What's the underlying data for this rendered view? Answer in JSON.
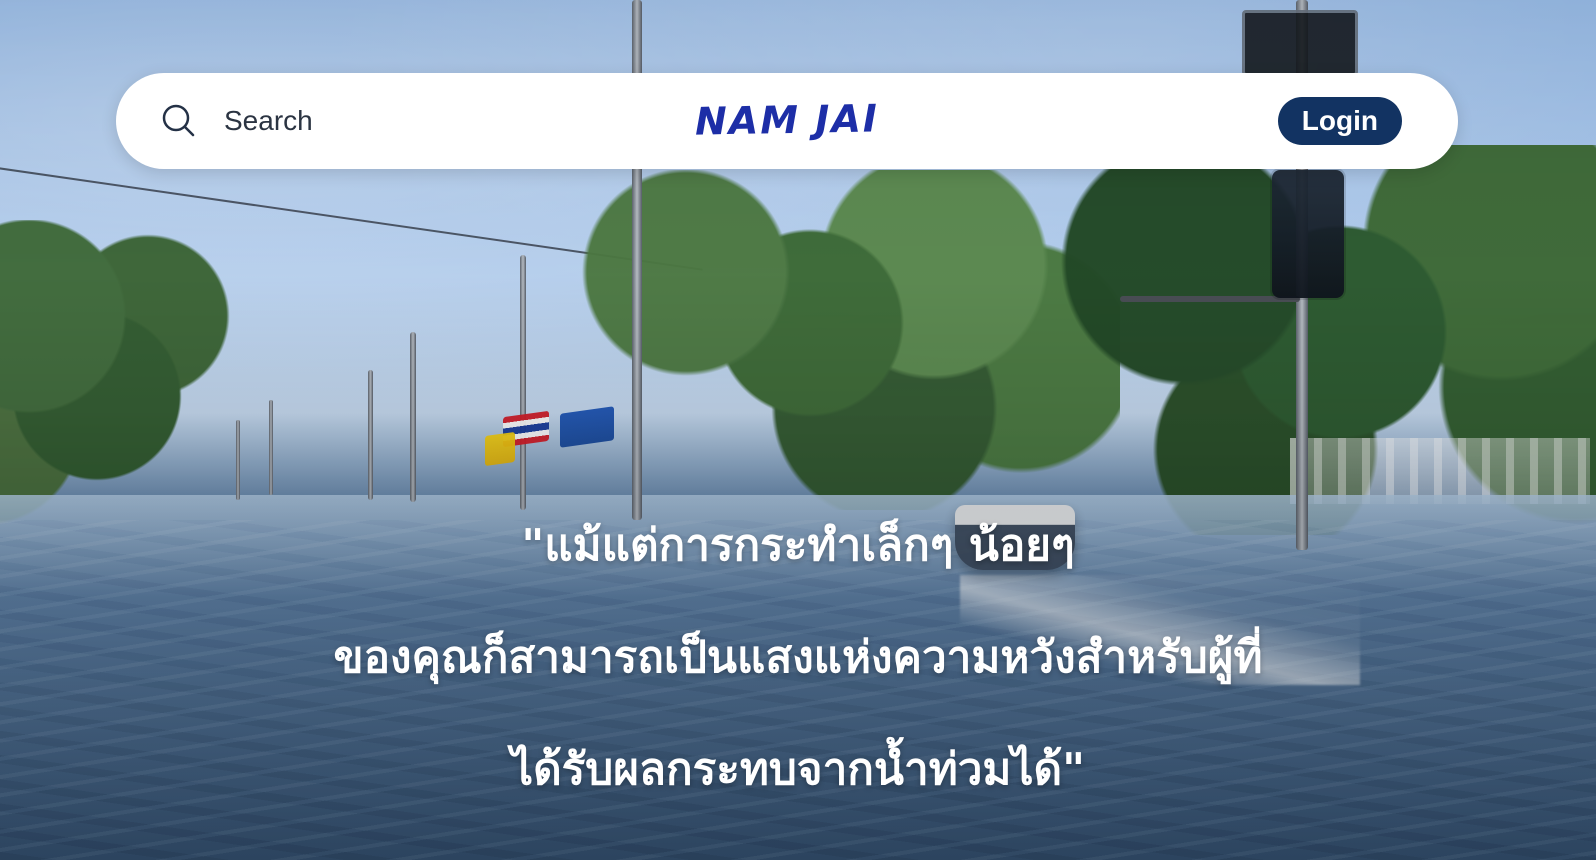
{
  "header": {
    "search": {
      "placeholder": "Search",
      "value": ""
    },
    "brand": "NAM JAI",
    "login_label": "Login"
  },
  "hero": {
    "quote_lines": [
      "\"แม้แต่การกระทำเล็กๆ น้อยๆ",
      "ของคุณก็สามารถเป็นแสงแห่งความหวังสำหรับผู้ที่",
      "ได้รับผลกระทบจากน้ำท่วมได้\""
    ]
  },
  "colors": {
    "navbar_bg": "#ffffff",
    "brand": "#1d2ea7",
    "login_button": "#123362",
    "quote_text": "#ffffff"
  },
  "icons": {
    "search": "search-icon"
  }
}
